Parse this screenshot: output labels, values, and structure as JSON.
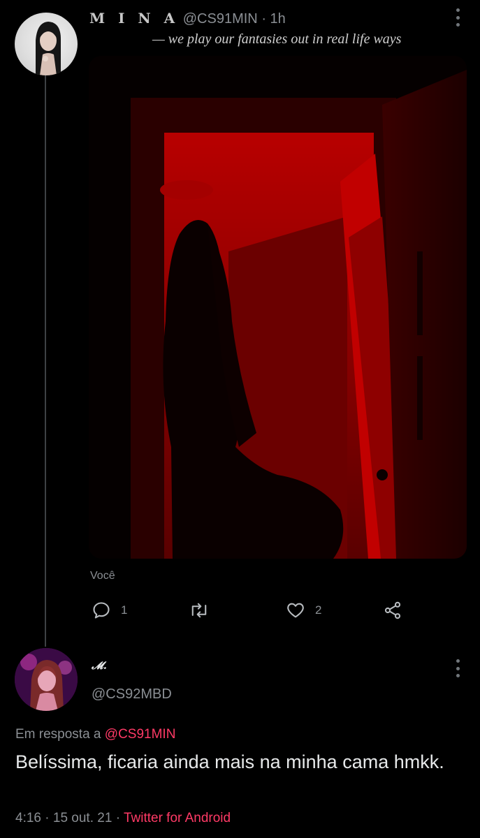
{
  "tweet1": {
    "display_name": "M I N A",
    "handle": "@CS91MIN",
    "separator": "·",
    "time": "1h",
    "bio": "— we play our fantasies out in real life ways",
    "media_label": "Você",
    "actions": {
      "reply_count": "1",
      "retweet_count": "",
      "like_count": "2"
    },
    "icons": {
      "reply": "reply-icon",
      "retweet": "retweet-icon",
      "like": "heart-icon",
      "share": "share-icon",
      "more": "more-vertical-icon"
    }
  },
  "tweet2": {
    "display_name": "𝓜.",
    "handle": "@CS92MBD",
    "reply_prefix": "Em resposta a",
    "reply_mention": "@CS91MIN",
    "text": "Belíssima, ficaria ainda mais na minha cama hmkk.",
    "time": "4:16",
    "dot1": "·",
    "date": "15 out. 21",
    "dot2": "·",
    "client": "Twitter for Android"
  },
  "colors": {
    "background": "#000000",
    "accent": "#ff3a66",
    "secondary_text": "#8b8f94",
    "primary_text": "#e7e9ea",
    "media_red": "#b00000"
  }
}
